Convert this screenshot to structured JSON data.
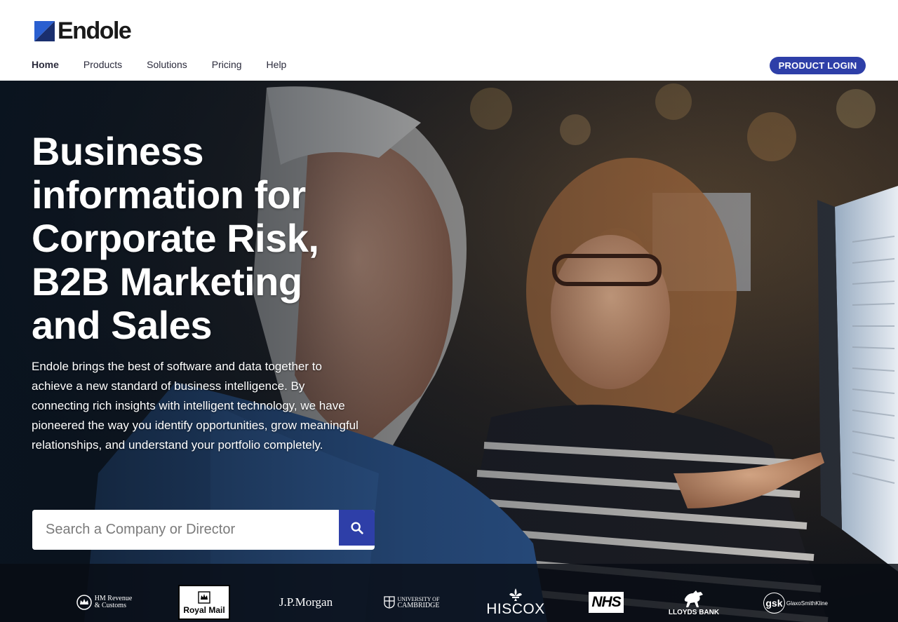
{
  "brand": {
    "name": "Endole",
    "accent": "#2e3fa8",
    "mark_colors": [
      "#2a5fd0",
      "#1a2f6e"
    ]
  },
  "nav": {
    "items": [
      {
        "label": "Home",
        "active": true
      },
      {
        "label": "Products",
        "active": false
      },
      {
        "label": "Solutions",
        "active": false
      },
      {
        "label": "Pricing",
        "active": false
      },
      {
        "label": "Help",
        "active": false
      }
    ],
    "login_label": "PRODUCT LOGIN"
  },
  "hero": {
    "title_lines": [
      "Business",
      "information for",
      "Corporate Risk,",
      "B2B Marketing",
      "and Sales"
    ],
    "description": "Endole brings the best of software and data together to achieve a new standard of business intelligence. By connecting rich insights with intelligent technology, we have pioneered the way you identify opportunities, grow meaningful relationships, and understand your portfolio completely."
  },
  "search": {
    "placeholder": "Search a Company or Director",
    "value": "",
    "button_icon": "search-icon"
  },
  "clients": [
    {
      "name": "HM Revenue & Customs",
      "lines": [
        "HM Revenue",
        "& Customs"
      ],
      "icon": "crown-icon"
    },
    {
      "name": "Royal Mail",
      "lines": [
        "Royal Mail"
      ],
      "icon": "crown-icon"
    },
    {
      "name": "J.P.Morgan",
      "lines": [
        "J.P.Morgan"
      ]
    },
    {
      "name": "University of Cambridge",
      "lines": [
        "UNIVERSITY OF",
        "CAMBRIDGE"
      ],
      "icon": "crest-icon"
    },
    {
      "name": "HISCOX",
      "lines": [
        "HISCOX"
      ],
      "icon": "fleur-de-lis-icon"
    },
    {
      "name": "NHS",
      "lines": [
        "NHS"
      ]
    },
    {
      "name": "Lloyds Bank",
      "lines": [
        "LLOYDS BANK"
      ],
      "icon": "horse-icon"
    },
    {
      "name": "GlaxoSmithKline",
      "lines": [
        "gsk",
        "GlaxoSmithKline"
      ]
    }
  ]
}
